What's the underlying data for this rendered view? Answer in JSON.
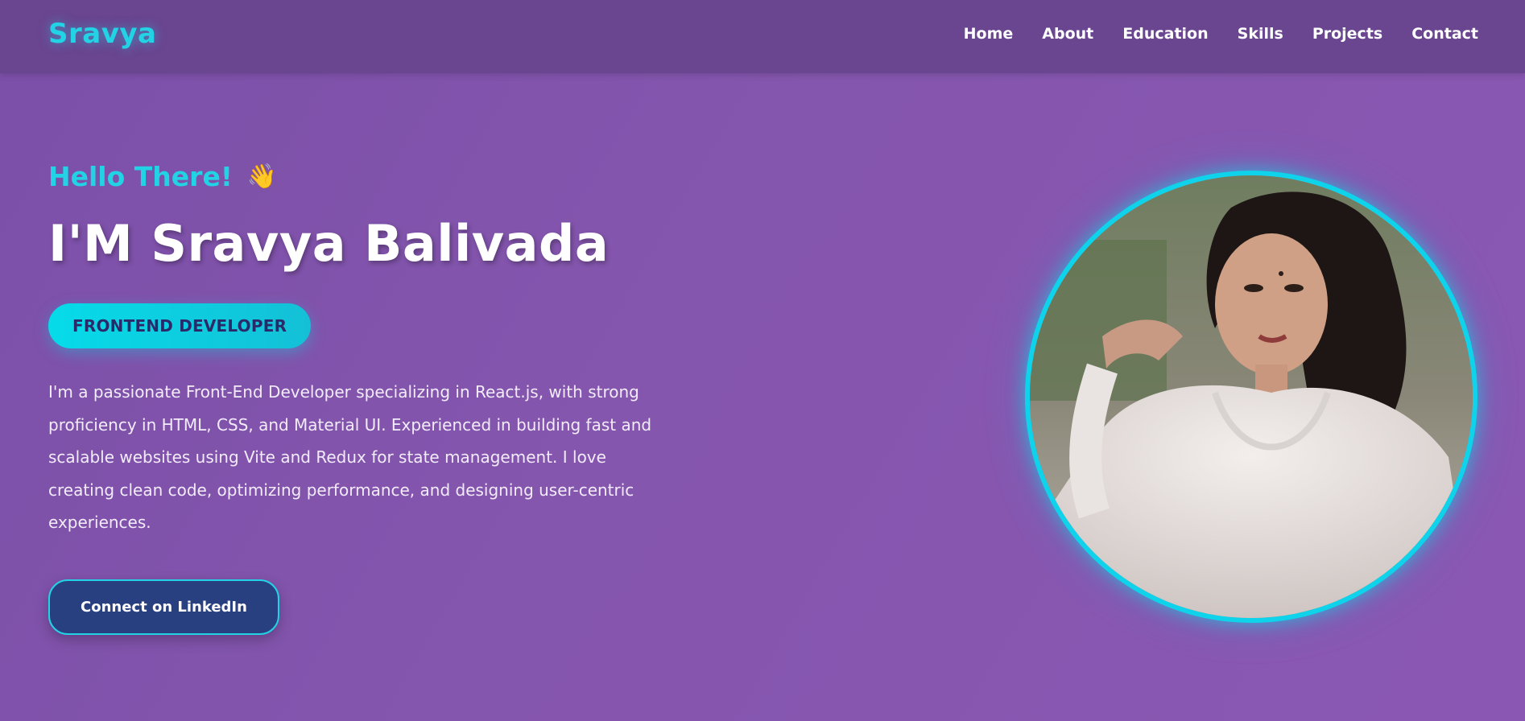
{
  "navbar": {
    "brand": "Sravya",
    "links": [
      "Home",
      "About",
      "Education",
      "Skills",
      "Projects",
      "Contact"
    ]
  },
  "hero": {
    "greeting": "Hello There!",
    "greeting_emoji": "👋",
    "name": "I'M Sravya Balivada",
    "role": "FRONTEND DEVELOPER",
    "bio": "I'm a passionate Front-End Developer specializing in React.js, with strong proficiency in HTML, CSS, and Material UI. Experienced in building fast and scalable websites using Vite and Redux for state management. I love creating clean code, optimizing performance, and designing user-centric experiences.",
    "cta": "Connect on LinkedIn"
  },
  "icons": [
    "wave-icon",
    "profile-photo"
  ],
  "colors": {
    "accent": "#22d3e6",
    "background": "#8556ae",
    "navbar": "#6a4590",
    "button": "#28407f"
  }
}
